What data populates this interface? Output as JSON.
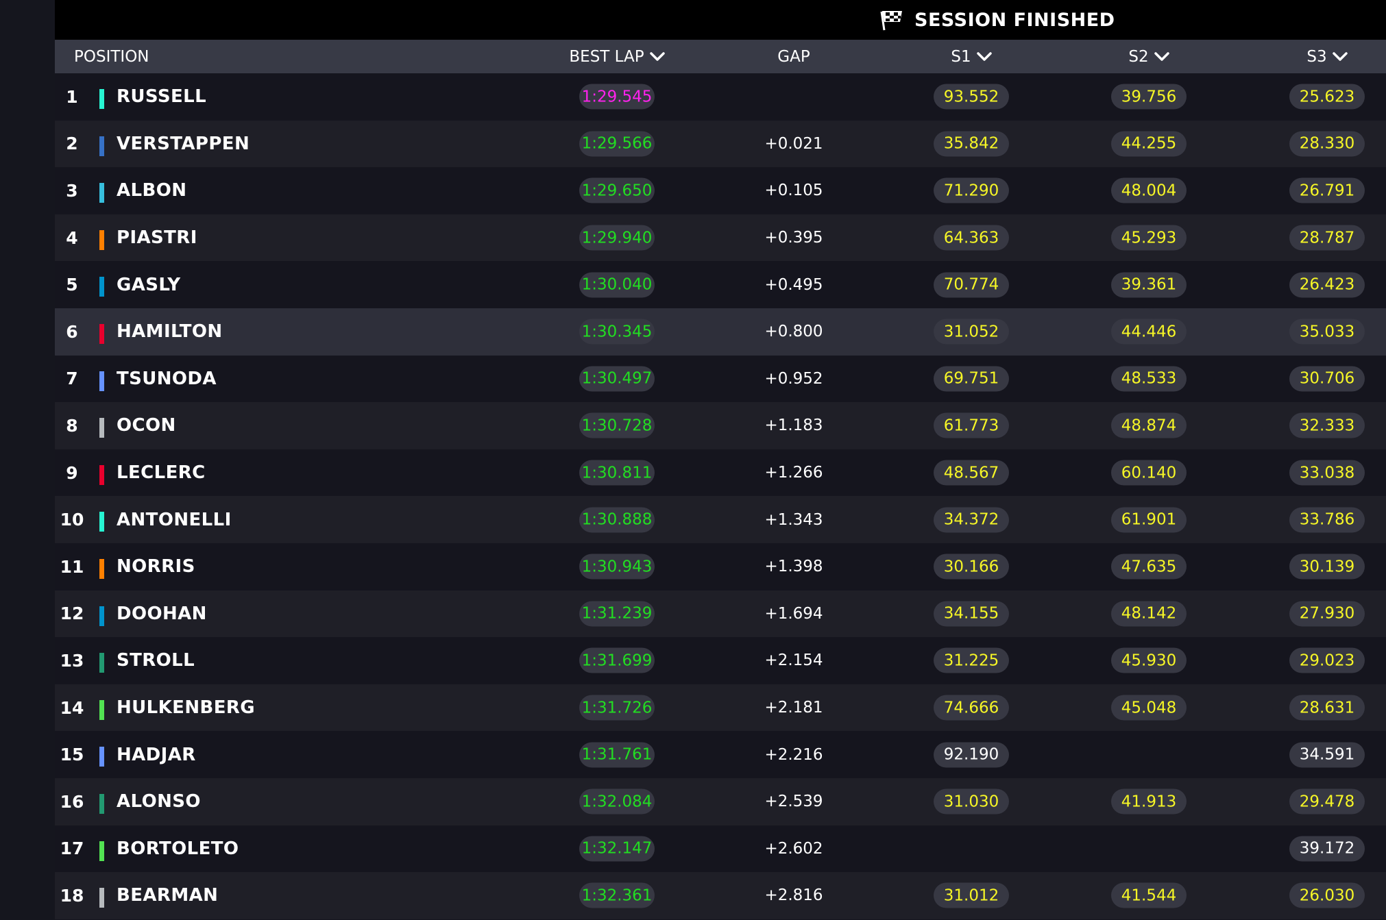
{
  "status": {
    "text": "SESSION FINISHED",
    "icon": "checkered-flag-icon"
  },
  "headers": {
    "position": "POSITION",
    "best_lap": "BEST LAP",
    "gap": "GAP",
    "s1": "S1",
    "s2": "S2",
    "s3": "S3"
  },
  "colors": {
    "fastest_lap": "#ff22ee",
    "personal_best": "#22dd22",
    "sector_yellow": "#f6f626",
    "header_bg": "#383a46",
    "status_bg": "#000000"
  },
  "rows": [
    {
      "pos": "1",
      "driver": "RUSSELL",
      "team_color": "#27f4d2",
      "best": "1:29.545",
      "fastest": true,
      "gap": "",
      "s1": "93.552",
      "s1c": "yellow",
      "s2": "39.756",
      "s2c": "yellow",
      "s3": "25.623",
      "s3c": "yellow"
    },
    {
      "pos": "2",
      "driver": "VERSTAPPEN",
      "team_color": "#3671c6",
      "best": "1:29.566",
      "fastest": false,
      "gap": "+0.021",
      "s1": "35.842",
      "s1c": "yellow",
      "s2": "44.255",
      "s2c": "yellow",
      "s3": "28.330",
      "s3c": "yellow"
    },
    {
      "pos": "3",
      "driver": "ALBON",
      "team_color": "#37bedd",
      "best": "1:29.650",
      "fastest": false,
      "gap": "+0.105",
      "s1": "71.290",
      "s1c": "yellow",
      "s2": "48.004",
      "s2c": "yellow",
      "s3": "26.791",
      "s3c": "yellow"
    },
    {
      "pos": "4",
      "driver": "PIASTRI",
      "team_color": "#ff8000",
      "best": "1:29.940",
      "fastest": false,
      "gap": "+0.395",
      "s1": "64.363",
      "s1c": "yellow",
      "s2": "45.293",
      "s2c": "yellow",
      "s3": "28.787",
      "s3c": "yellow"
    },
    {
      "pos": "5",
      "driver": "GASLY",
      "team_color": "#0093cc",
      "best": "1:30.040",
      "fastest": false,
      "gap": "+0.495",
      "s1": "70.774",
      "s1c": "yellow",
      "s2": "39.361",
      "s2c": "yellow",
      "s3": "26.423",
      "s3c": "yellow"
    },
    {
      "pos": "6",
      "driver": "HAMILTON",
      "team_color": "#e8002d",
      "best": "1:30.345",
      "fastest": false,
      "gap": "+0.800",
      "s1": "31.052",
      "s1c": "yellow",
      "s2": "44.446",
      "s2c": "yellow",
      "s3": "35.033",
      "s3c": "yellow",
      "highlight": true
    },
    {
      "pos": "7",
      "driver": "TSUNODA",
      "team_color": "#6692ff",
      "best": "1:30.497",
      "fastest": false,
      "gap": "+0.952",
      "s1": "69.751",
      "s1c": "yellow",
      "s2": "48.533",
      "s2c": "yellow",
      "s3": "30.706",
      "s3c": "yellow"
    },
    {
      "pos": "8",
      "driver": "OCON",
      "team_color": "#b6babd",
      "best": "1:30.728",
      "fastest": false,
      "gap": "+1.183",
      "s1": "61.773",
      "s1c": "yellow",
      "s2": "48.874",
      "s2c": "yellow",
      "s3": "32.333",
      "s3c": "yellow"
    },
    {
      "pos": "9",
      "driver": "LECLERC",
      "team_color": "#e8002d",
      "best": "1:30.811",
      "fastest": false,
      "gap": "+1.266",
      "s1": "48.567",
      "s1c": "yellow",
      "s2": "60.140",
      "s2c": "yellow",
      "s3": "33.038",
      "s3c": "yellow"
    },
    {
      "pos": "10",
      "driver": "ANTONELLI",
      "team_color": "#27f4d2",
      "best": "1:30.888",
      "fastest": false,
      "gap": "+1.343",
      "s1": "34.372",
      "s1c": "yellow",
      "s2": "61.901",
      "s2c": "yellow",
      "s3": "33.786",
      "s3c": "yellow"
    },
    {
      "pos": "11",
      "driver": "NORRIS",
      "team_color": "#ff8000",
      "best": "1:30.943",
      "fastest": false,
      "gap": "+1.398",
      "s1": "30.166",
      "s1c": "yellow",
      "s2": "47.635",
      "s2c": "yellow",
      "s3": "30.139",
      "s3c": "yellow"
    },
    {
      "pos": "12",
      "driver": "DOOHAN",
      "team_color": "#0093cc",
      "best": "1:31.239",
      "fastest": false,
      "gap": "+1.694",
      "s1": "34.155",
      "s1c": "yellow",
      "s2": "48.142",
      "s2c": "yellow",
      "s3": "27.930",
      "s3c": "yellow"
    },
    {
      "pos": "13",
      "driver": "STROLL",
      "team_color": "#229971",
      "best": "1:31.699",
      "fastest": false,
      "gap": "+2.154",
      "s1": "31.225",
      "s1c": "yellow",
      "s2": "45.930",
      "s2c": "yellow",
      "s3": "29.023",
      "s3c": "yellow"
    },
    {
      "pos": "14",
      "driver": "HULKENBERG",
      "team_color": "#52e252",
      "best": "1:31.726",
      "fastest": false,
      "gap": "+2.181",
      "s1": "74.666",
      "s1c": "yellow",
      "s2": "45.048",
      "s2c": "yellow",
      "s3": "28.631",
      "s3c": "yellow"
    },
    {
      "pos": "15",
      "driver": "HADJAR",
      "team_color": "#6692ff",
      "best": "1:31.761",
      "fastest": false,
      "gap": "+2.216",
      "s1": "92.190",
      "s1c": "white",
      "s2": "",
      "s2c": "white",
      "s3": "34.591",
      "s3c": "white"
    },
    {
      "pos": "16",
      "driver": "ALONSO",
      "team_color": "#229971",
      "best": "1:32.084",
      "fastest": false,
      "gap": "+2.539",
      "s1": "31.030",
      "s1c": "yellow",
      "s2": "41.913",
      "s2c": "yellow",
      "s3": "29.478",
      "s3c": "yellow"
    },
    {
      "pos": "17",
      "driver": "BORTOLETO",
      "team_color": "#52e252",
      "best": "1:32.147",
      "fastest": false,
      "gap": "+2.602",
      "s1": "",
      "s1c": "white",
      "s2": "",
      "s2c": "white",
      "s3": "39.172",
      "s3c": "white"
    },
    {
      "pos": "18",
      "driver": "BEARMAN",
      "team_color": "#b6babd",
      "best": "1:32.361",
      "fastest": false,
      "gap": "+2.816",
      "s1": "31.012",
      "s1c": "yellow",
      "s2": "41.544",
      "s2c": "yellow",
      "s3": "26.030",
      "s3c": "yellow"
    }
  ]
}
